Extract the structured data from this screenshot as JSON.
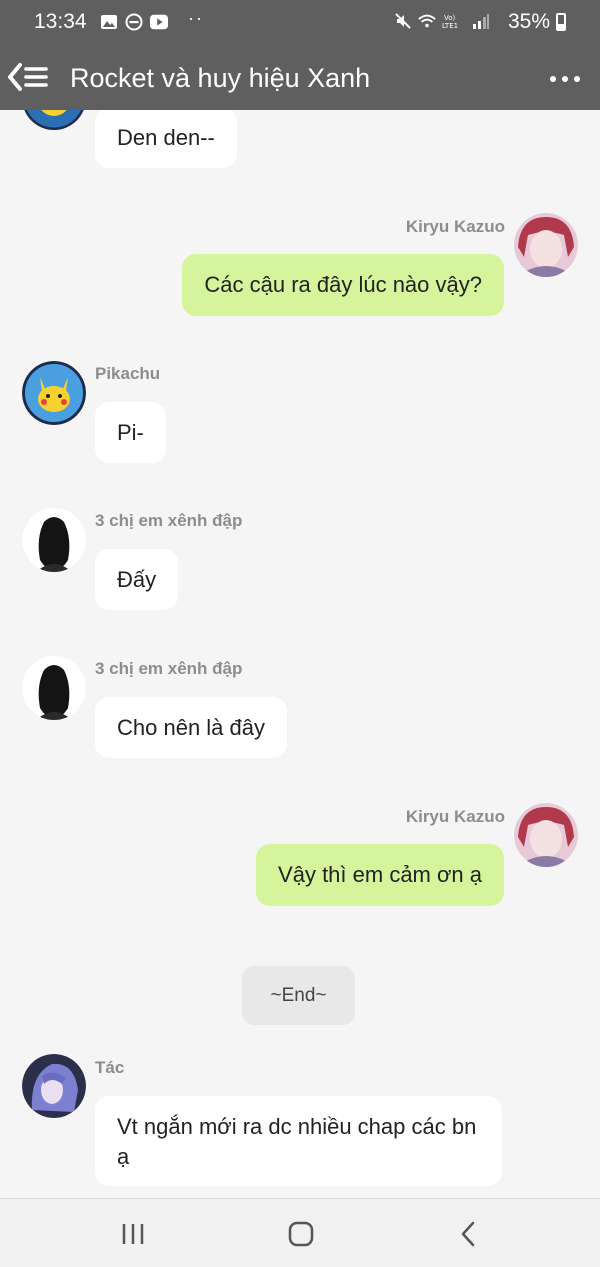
{
  "status_bar": {
    "time": "13:34",
    "dots": "··",
    "battery_percent": "35%"
  },
  "app_bar": {
    "title": "Rocket và huy hiệu Xanh"
  },
  "messages": [
    {
      "side": "in",
      "sender": "",
      "text": "Den den--",
      "avatar": "pikachu-avatar"
    },
    {
      "side": "out",
      "sender": "Kiryu Kazuo",
      "text": "Các cậu ra đây lúc nào vậy?",
      "avatar": "kiryu-avatar"
    },
    {
      "side": "in",
      "sender": "Pikachu",
      "text": "Pi-",
      "avatar": "pikachu-avatar"
    },
    {
      "side": "in",
      "sender": "3 chị em xênh đập",
      "text": "Đấy",
      "avatar": "silhouette-avatar"
    },
    {
      "side": "in",
      "sender": "3 chị em xênh đập",
      "text": "Cho nên là đây",
      "avatar": "silhouette-avatar"
    },
    {
      "side": "out",
      "sender": "Kiryu Kazuo",
      "text": "Vậy thì em cảm ơn ạ",
      "avatar": "kiryu-avatar"
    },
    {
      "side": "system",
      "text": "~End~"
    },
    {
      "side": "in",
      "sender": "Tác",
      "text": "Vt ngắn mới ra dc nhiều chap các bn ạ",
      "avatar": "tac-avatar"
    }
  ],
  "colors": {
    "app_bar": "#5f5f5f",
    "background": "#f5f5f5",
    "outgoing_bubble": "#d6f49b",
    "incoming_bubble": "#ffffff"
  }
}
